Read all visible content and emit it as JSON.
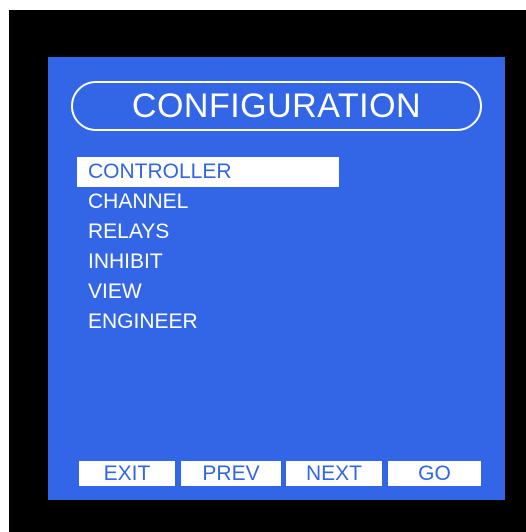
{
  "screen": {
    "title": "CONFIGURATION",
    "menu": [
      {
        "label": "CONTROLLER",
        "selected": true
      },
      {
        "label": "CHANNEL",
        "selected": false
      },
      {
        "label": "RELAYS",
        "selected": false
      },
      {
        "label": "INHIBIT",
        "selected": false
      },
      {
        "label": "VIEW",
        "selected": false
      },
      {
        "label": "ENGINEER",
        "selected": false
      }
    ],
    "softkeys": {
      "exit": "EXIT",
      "prev": "PREV",
      "next": "NEXT",
      "go": "GO"
    }
  },
  "colors": {
    "screen_background": "#3366e6",
    "bezel": "#000000",
    "text": "#ffffff"
  }
}
